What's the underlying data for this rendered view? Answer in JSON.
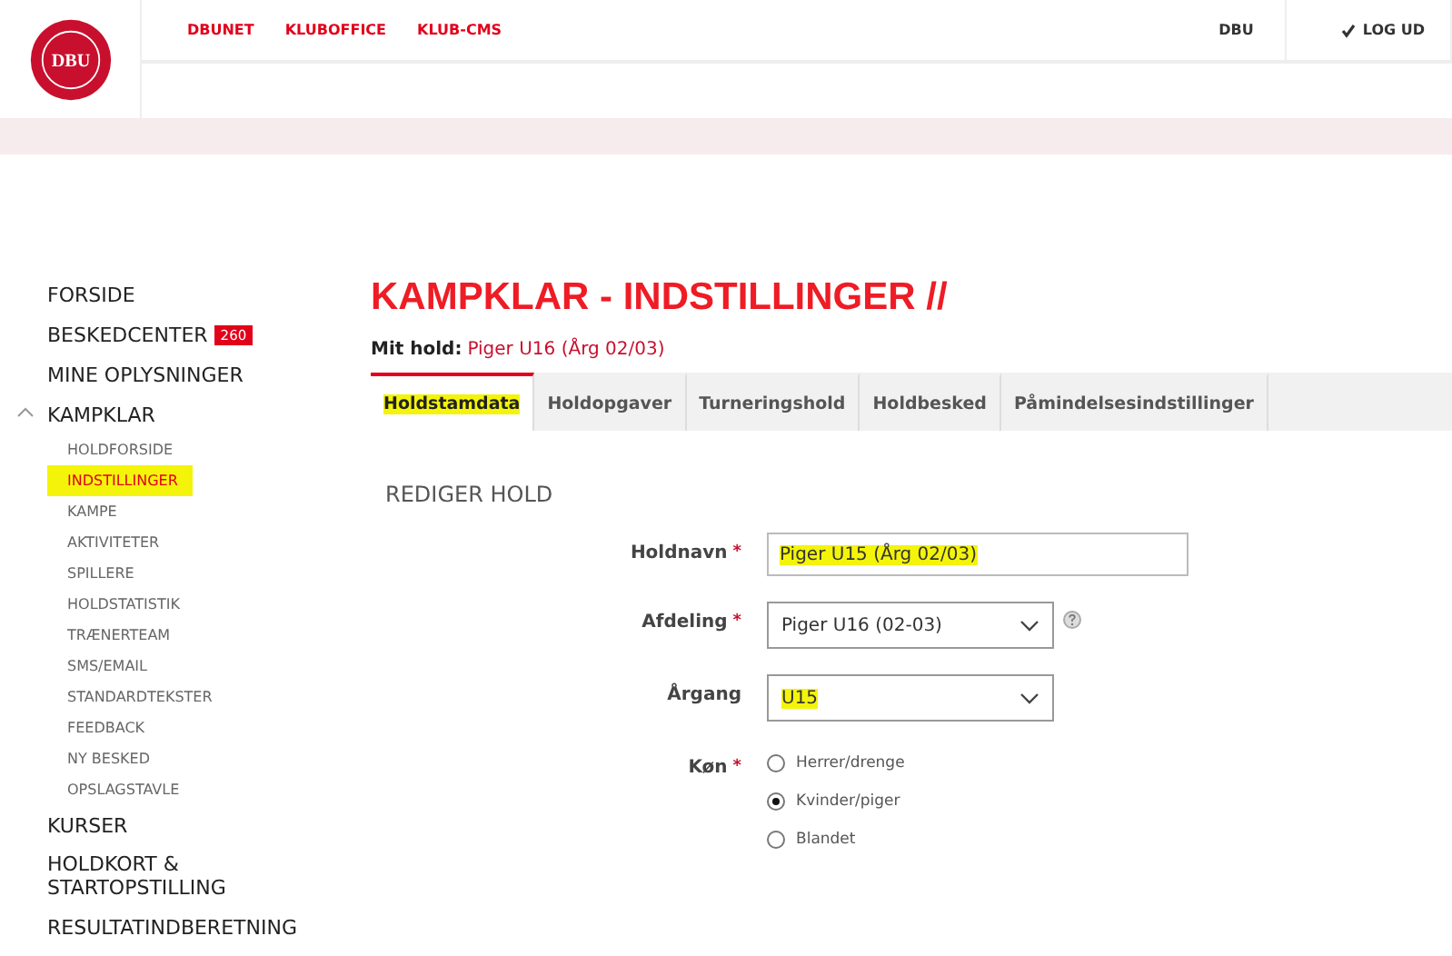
{
  "logo": {
    "text": "DBU"
  },
  "top_nav": [
    {
      "label": "DBUNET"
    },
    {
      "label": "KLUBOFFICE"
    },
    {
      "label": "KLUB-CMS"
    }
  ],
  "top_right": {
    "org": "DBU",
    "logout": "LOG UD"
  },
  "sidebar": {
    "items": [
      {
        "label": "FORSIDE"
      },
      {
        "label": "BESKEDCENTER",
        "badge": "260"
      },
      {
        "label": "MINE OPLYSNINGER"
      },
      {
        "label": "KAMPKLAR",
        "expanded": true,
        "children": [
          {
            "label": "HOLDFORSIDE",
            "selected": false,
            "highlighted": false
          },
          {
            "label": "INDSTILLINGER",
            "selected": true,
            "highlighted": true
          },
          {
            "label": "KAMPE",
            "selected": false,
            "highlighted": false
          },
          {
            "label": "AKTIVITETER",
            "selected": false,
            "highlighted": false
          },
          {
            "label": "SPILLERE",
            "selected": false,
            "highlighted": false
          },
          {
            "label": "HOLDSTATISTIK",
            "selected": false,
            "highlighted": false
          },
          {
            "label": "TRÆNERTEAM",
            "selected": false,
            "highlighted": false
          },
          {
            "label": "SMS/EMAIL",
            "selected": false,
            "highlighted": false
          },
          {
            "label": "STANDARDTEKSTER",
            "selected": false,
            "highlighted": false
          },
          {
            "label": "FEEDBACK",
            "selected": false,
            "highlighted": false
          },
          {
            "label": "NY BESKED",
            "selected": false,
            "highlighted": false
          },
          {
            "label": "OPSLAGSTAVLE",
            "selected": false,
            "highlighted": false
          }
        ]
      },
      {
        "label": "KURSER"
      },
      {
        "label": "HOLDKORT & STARTOPSTILLING"
      },
      {
        "label": "RESULTATINDBERETNING"
      }
    ]
  },
  "page_title": "KAMPKLAR - INDSTILLINGER //",
  "my_team": {
    "label": "Mit hold:",
    "value": "Piger U16 (Årg 02/03)"
  },
  "tabs": [
    {
      "label": "Holdstamdata",
      "selected": true,
      "highlighted": true
    },
    {
      "label": "Holdopgaver",
      "selected": false,
      "highlighted": false
    },
    {
      "label": "Turneringshold",
      "selected": false,
      "highlighted": false
    },
    {
      "label": "Holdbesked",
      "selected": false,
      "highlighted": false
    },
    {
      "label": "Påmindelsesindstillinger",
      "selected": false,
      "highlighted": false
    }
  ],
  "section_title": "REDIGER HOLD",
  "form": [
    {
      "kind": "text",
      "label": "Holdnavn",
      "required_mark": "*",
      "value": "Piger U15 (Årg 02/03)",
      "highlighted": true
    },
    {
      "kind": "select",
      "label": "Afdeling",
      "required_mark": "*",
      "value": "Piger U16 (02-03)",
      "highlighted": false,
      "help": true
    },
    {
      "kind": "select",
      "label": "Årgang",
      "value": "U15",
      "highlighted": true,
      "help": false
    },
    {
      "kind": "radio",
      "label": "Køn",
      "required_mark": "*",
      "options": [
        {
          "label": "Herrer/drenge",
          "selected": false
        },
        {
          "label": "Kvinder/piger",
          "selected": true
        },
        {
          "label": "Blandet",
          "selected": false
        }
      ]
    }
  ]
}
